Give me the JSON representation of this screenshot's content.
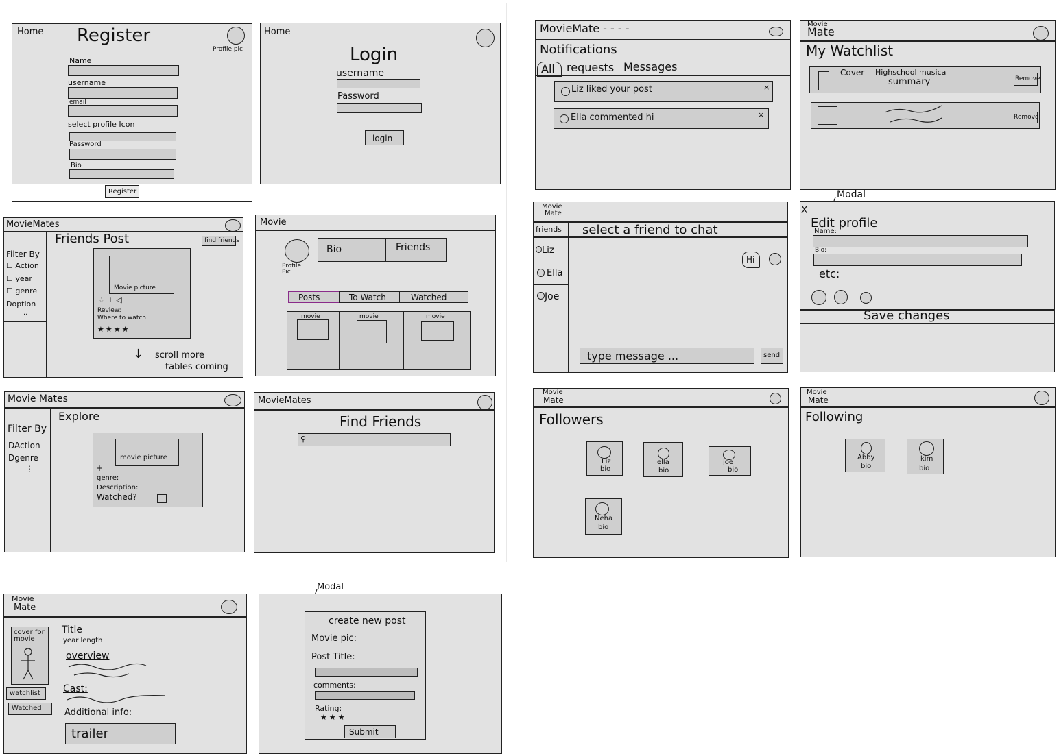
{
  "register": {
    "home": "Home",
    "title": "Register",
    "profile_pic": "Profile pic",
    "name": "Name",
    "username": "username",
    "email": "email",
    "select_icon": "select profile Icon",
    "password": "Password",
    "bio": "Bio",
    "button": "Register"
  },
  "login": {
    "home": "Home",
    "title": "Login",
    "username": "username",
    "password": "Password",
    "button": "login"
  },
  "friends_post": {
    "app": "MovieMates",
    "title": "Friends Post",
    "find_friends": "find friends",
    "filter": "Filter By",
    "filters": [
      "Action",
      "year",
      "genre",
      "Doption"
    ],
    "movie_picture": "Movie picture",
    "reactions": "♡ + ◁",
    "review": "Review:",
    "where": "Where to watch:",
    "stars": "★★★★",
    "scroll": "scroll more",
    "tables": "tables coming"
  },
  "profile": {
    "app": "Movie",
    "profile_pic": "Profile Pic",
    "bio": "Bio",
    "friends": "Friends",
    "tabs": [
      "Posts",
      "To Watch",
      "Watched"
    ],
    "movie": "movie"
  },
  "explore": {
    "app": "Movie Mates",
    "title": "Explore",
    "filter": "Filter By",
    "filters": [
      "DAction",
      "Dgenre",
      "⋮"
    ],
    "movie_picture": "movie picture",
    "plus": "+",
    "genre": "genre:",
    "description": "Description:",
    "watched": "Watched?"
  },
  "find_friends": {
    "app": "MovieMates",
    "title": "Find Friends",
    "search_icon": "search-icon"
  },
  "details": {
    "app1": "Movie",
    "app2": "Mate",
    "cover": "cover for movie",
    "title": "Title",
    "year": "year length",
    "overview": "overview",
    "cast": "Cast:",
    "watchlist": "watchlist",
    "watched": "Watched",
    "additional": "Additional info:",
    "trailer": "trailer"
  },
  "create_post": {
    "modal": "Modal",
    "title": "create new post",
    "movie_pic": "Movie pic:",
    "post_title": "Post Title:",
    "comments": "comments:",
    "rating": "Rating:",
    "stars": "★★★",
    "submit": "Submit"
  },
  "notifications": {
    "app": "MovieMate - - - -",
    "title": "Notifications",
    "tabs": [
      "All",
      "requests",
      "Messages"
    ],
    "items": [
      "Liz liked your post",
      "Ella commented hi"
    ],
    "close": "×"
  },
  "watchlist": {
    "app1": "Movie",
    "app2": "Mate",
    "title": "My Watchlist",
    "cover": "Cover",
    "movie": "Highschool musica",
    "summary": "summary",
    "remove": "Remove"
  },
  "chat": {
    "app1": "Movie",
    "app2": "Mate",
    "friends": "friends",
    "prompt": "select a friend to chat",
    "contacts": [
      "Liz",
      "Ella",
      "Joe"
    ],
    "bubble": "Hi",
    "input": "type message ...",
    "send": "send"
  },
  "edit_profile": {
    "modal": "Modal",
    "close": "X",
    "title": "Edit profile",
    "name": "Name:",
    "bio": "Bio:",
    "etc": "etc:",
    "save": "Save changes"
  },
  "followers": {
    "app1": "Movie",
    "app2": "Mate",
    "title": "Followers",
    "people": [
      {
        "name": "Liz",
        "bio": "bio"
      },
      {
        "name": "ella",
        "bio": "bio"
      },
      {
        "name": "joe",
        "bio": "bio"
      },
      {
        "name": "Neha",
        "bio": "bio"
      }
    ]
  },
  "following": {
    "app1": "Movie",
    "app2": "Mate",
    "title": "Following",
    "people": [
      {
        "name": "Abby",
        "bio": "bio"
      },
      {
        "name": "kim",
        "bio": "bio"
      }
    ]
  }
}
